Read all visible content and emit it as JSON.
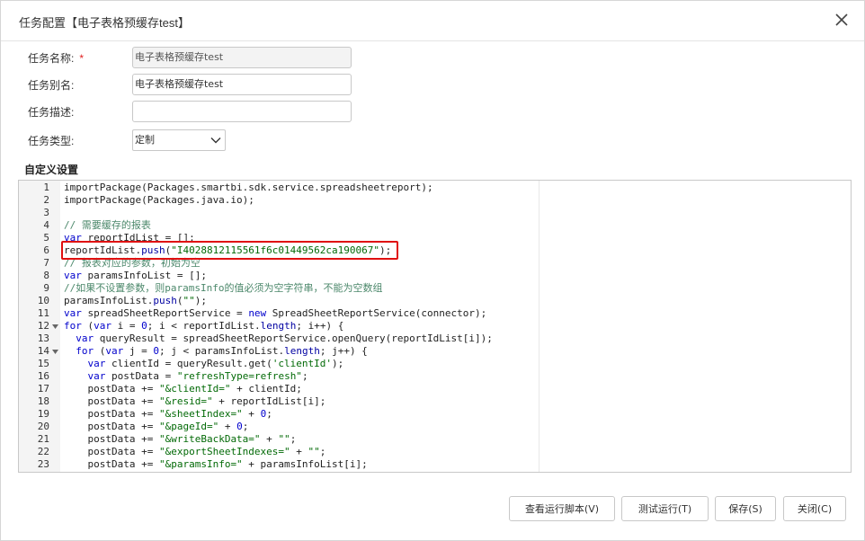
{
  "dialog": {
    "title": "任务配置【电子表格预缓存test】"
  },
  "icons": {
    "close": "close-icon",
    "dropdown": "chevron-down-icon",
    "fold": "fold-arrow-icon"
  },
  "form": {
    "name_label": "任务名称:",
    "name_required": "*",
    "name_value": "电子表格预缓存test",
    "alias_label": "任务别名:",
    "alias_value": "电子表格预缓存test",
    "desc_label": "任务描述:",
    "desc_value": "",
    "type_label": "任务类型:",
    "type_value": "定制"
  },
  "custom_section": {
    "title": "自定义设置"
  },
  "code_lines": [
    {
      "n": "1",
      "fold": false,
      "code": "importPackage(Packages.smartbi.sdk.service.spreadsheetreport);"
    },
    {
      "n": "2",
      "fold": false,
      "code": "importPackage(Packages.java.io);"
    },
    {
      "n": "3",
      "fold": false,
      "code": ""
    },
    {
      "n": "4",
      "fold": false,
      "code": "// 需要缓存的报表"
    },
    {
      "n": "5",
      "fold": false,
      "code": "var reportIdList = [];"
    },
    {
      "n": "6",
      "fold": false,
      "code": "reportIdList.push(\"I4028812115561f6c01449562ca190067\");"
    },
    {
      "n": "7",
      "fold": false,
      "code": "// 报表对应的参数，初始为空"
    },
    {
      "n": "8",
      "fold": false,
      "code": "var paramsInfoList = [];"
    },
    {
      "n": "9",
      "fold": false,
      "code": "//如果不设置参数，则paramsInfo的值必须为空字符串，不能为空数组"
    },
    {
      "n": "10",
      "fold": false,
      "code": "paramsInfoList.push(\"\");"
    },
    {
      "n": "11",
      "fold": false,
      "code": "var spreadSheetReportService = new SpreadSheetReportService(connector);"
    },
    {
      "n": "12",
      "fold": true,
      "code": "for (var i = 0; i < reportIdList.length; i++) {"
    },
    {
      "n": "13",
      "fold": false,
      "code": "  var queryResult = spreadSheetReportService.openQuery(reportIdList[i]);"
    },
    {
      "n": "14",
      "fold": true,
      "code": "  for (var j = 0; j < paramsInfoList.length; j++) {"
    },
    {
      "n": "15",
      "fold": false,
      "code": "    var clientId = queryResult.get('clientId');"
    },
    {
      "n": "16",
      "fold": false,
      "code": "    var postData = \"refreshType=refresh\";"
    },
    {
      "n": "17",
      "fold": false,
      "code": "    postData += \"&clientId=\" + clientId;"
    },
    {
      "n": "18",
      "fold": false,
      "code": "    postData += \"&resid=\" + reportIdList[i];"
    },
    {
      "n": "19",
      "fold": false,
      "code": "    postData += \"&sheetIndex=\" + 0;"
    },
    {
      "n": "20",
      "fold": false,
      "code": "    postData += \"&pageId=\" + 0;"
    },
    {
      "n": "21",
      "fold": false,
      "code": "    postData += \"&writeBackData=\" + \"\";"
    },
    {
      "n": "22",
      "fold": false,
      "code": "    postData += \"&exportSheetIndexes=\" + \"\";"
    },
    {
      "n": "23",
      "fold": false,
      "code": "    postData += \"&paramsInfo=\" + paramsInfoList[i];"
    }
  ],
  "ghost_text": "",
  "footer": {
    "view_script": "查看运行脚本(V)",
    "test_run": "测试运行(T)",
    "save": "保存(S)",
    "close": "关闭(C)"
  },
  "colors": {
    "highlight_border": "#e01010",
    "required": "#e02020"
  }
}
